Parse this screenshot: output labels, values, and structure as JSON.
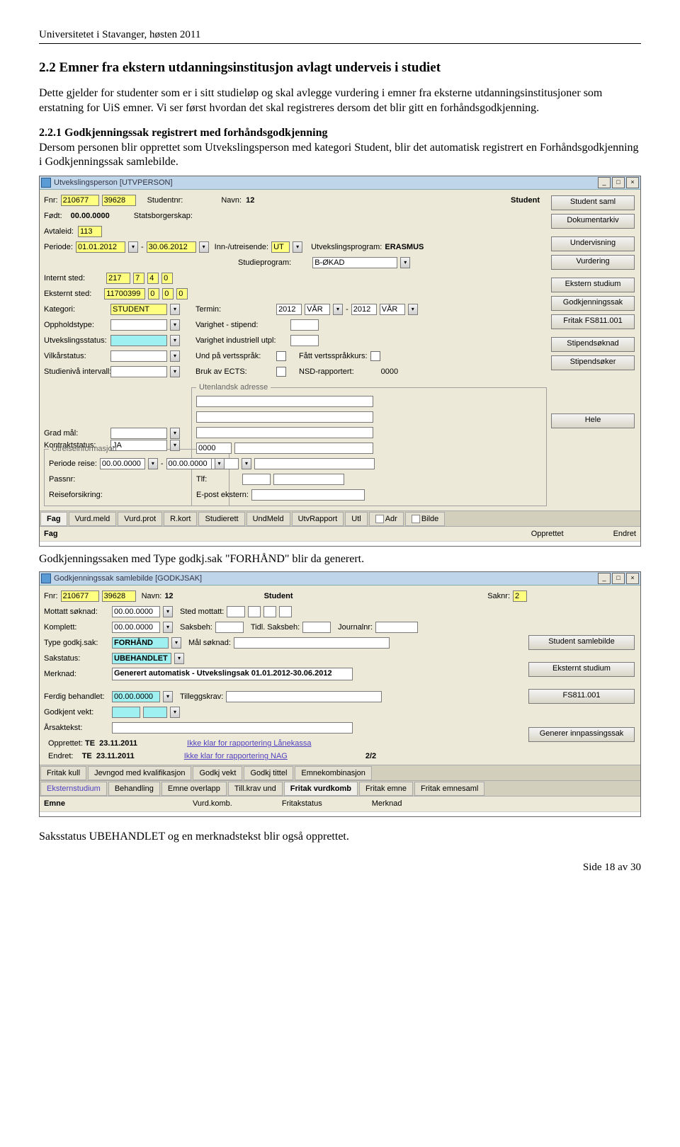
{
  "header": {
    "left": "Universitetet i Stavanger, høsten 2011",
    "right": ""
  },
  "h_section": "2.2 Emner fra ekstern utdanningsinstitusjon avlagt underveis i studiet",
  "intro": "Dette gjelder for studenter som er i sitt studieløp og skal avlegge vurdering i emner fra eksterne utdanningsinstitusjoner som erstatning for UiS emner. Vi ser først hvordan det skal registreres dersom det blir gitt en forhåndsgodkjenning.",
  "subhead": "2.2.1 Godkjenningssak registrert med forhåndsgodkjenning",
  "subtext": "Dersom personen blir opprettet som Utvekslingsperson med kategori Student, blir det automatisk registrert en Forhåndsgodkjenning i Godkjenningssak samlebilde.",
  "caption_mid": "Godkjenningssaken med Type godkj.sak \"FORHÅND\" blir da generert.",
  "foot_line": "Saksstatus UBEHANDLET og en merknadstekst blir også opprettet.",
  "page_footer": "Side 18 av 30",
  "up": {
    "title": "Utvekslingsperson  [UTVPERSON]",
    "fnr1": "210677",
    "fnr2": "39628",
    "studentnr_lbl": "Studentnr:",
    "navn_lbl": "Navn:",
    "navn_val": "12",
    "student_mark": "Student",
    "fodt_lbl": "Født:",
    "fodt_val": "00.00.0000",
    "stats_lbl": "Statsborgerskap:",
    "avtale_lbl": "Avtaleid:",
    "avtale_val": "113",
    "periode_lbl": "Periode:",
    "p_from": "01.01.2012",
    "p_to": "30.06.2012",
    "innut_lbl": "Inn-/utreisende:",
    "innut_val": "UT",
    "uprog_lbl": "Utvekslingsprogram:",
    "uprog_val": "ERASMUS",
    "sprog_lbl": "Studieprogram:",
    "sprog_val": "B-ØKAD",
    "isted_lbl": "Internt sted:",
    "isted_v1": "217",
    "isted_v2": "7",
    "isted_v3": "4",
    "isted_v4": "0",
    "ested_lbl": "Eksternt sted:",
    "ested_v1": "11700399",
    "ested_v2": "0",
    "ested_v3": "0",
    "ested_v4": "0",
    "kat_lbl": "Kategori:",
    "kat_val": "STUDENT",
    "term_lbl": "Termin:",
    "term_y1": "2012",
    "term_s1": "VÅR",
    "term_y2": "2012",
    "term_s2": "VÅR",
    "opph_lbl": "Oppholdstype:",
    "varst_lbl": "Varighet - stipend:",
    "ustat_lbl": "Utvekslingsstatus:",
    "varind_lbl": "Varighet industriell utpl:",
    "vilk_lbl": "Vilkårstatus:",
    "undv_lbl": "Und på vertsspråk:",
    "fvk_lbl": "Fått vertsspråkkurs:",
    "stniv_lbl": "Studienivå intervall:",
    "ects_lbl": "Bruk av ECTS:",
    "nsd_lbl": "NSD-rapportert:",
    "nsd_val": "0000",
    "kontr_lbl": "Kontraktstatus:",
    "kontr_val": "JA",
    "grad_lbl": "Grad mål:",
    "utenl_leg": "Utenlandsk adresse",
    "utreise_leg": "Utreiseinformasjon",
    "per_lbl": "Periode reise:",
    "per_from": "00.00.0000",
    "per_to": "00.00.0000",
    "pass_lbl": "Passnr:",
    "reise_lbl": "Reiseforsikring:",
    "addr_zero": "0000",
    "tlf_lbl": "Tlf:",
    "epost_lbl": "E-post ekstern:",
    "sidebtns": [
      "Student saml",
      "Dokumentarkiv",
      "Undervisning",
      "Vurdering",
      "Ekstern studium",
      "Godkjenningssak",
      "Fritak FS811.001",
      "Stipendsøknad",
      "Stipendsøker"
    ],
    "hele_btn": "Hele",
    "tabs": [
      "Fag",
      "Vurd.meld",
      "Vurd.prot",
      "R.kort",
      "Studierett",
      "UndMeld",
      "UtvRapport",
      "Utl",
      "Adr",
      "Bilde"
    ],
    "listcols": [
      "Fag",
      "Opprettet",
      "Endret"
    ]
  },
  "gs": {
    "title": "Godkjenningssak samlebilde  [GODKJSAK]",
    "fnr1": "210677",
    "fnr2": "39628",
    "navn_lbl": "Navn:",
    "navn_val": "12",
    "student_mark": "Student",
    "saknr_lbl": "Saknr:",
    "saknr_val": "2",
    "motts_lbl": "Mottatt søknad:",
    "motts_val": "00.00.0000",
    "stedm_lbl": "Sted mottatt:",
    "kompl_lbl": "Komplett:",
    "kompl_val": "00.00.0000",
    "saksb_lbl": "Saksbeh:",
    "tidlsb_lbl": "Tidl. Saksbeh:",
    "jnr_lbl": "Journalnr:",
    "type_lbl": "Type godkj.sak:",
    "type_val": "FORHÅND",
    "mals_lbl": "Mål søknad:",
    "sstat_lbl": "Sakstatus:",
    "sstat_val": "UBEHANDLET",
    "merk_lbl": "Merknad:",
    "merk_val": "Generert automatisk - Utvekslingsak 01.01.2012-30.06.2012",
    "ferd_lbl": "Ferdig behandlet:",
    "ferd_val": "00.00.0000",
    "tk_lbl": "Tilleggskrav:",
    "gv_lbl": "Godkjent vekt:",
    "aarsak_lbl": "Årsaktekst:",
    "opp_lbl": "Opprettet:",
    "opp_who": "TE",
    "opp_d": "23.11.2011",
    "end_lbl": "Endret:",
    "end_who": "TE",
    "end_d": "23.11.2011",
    "link1": "Ikke klar for rapportering Lånekassa",
    "link2": "Ikke klar for rapportering NAG",
    "pager": "2/2",
    "sidebtns": [
      "Student samlebilde",
      "Eksternt studium",
      "FS811.001",
      "Generer innpassingssak"
    ],
    "tabs1": [
      "Fritak kull",
      "Jevngod med kvalifikasjon",
      "Godkj vekt",
      "Godkj tittel",
      "Emnekombinasjon"
    ],
    "tabs2": [
      "Eksternstudium",
      "Behandling",
      "Emne overlapp",
      "Till.krav und",
      "Fritak vurdkomb",
      "Fritak emne",
      "Fritak emnesaml"
    ],
    "listcols": [
      "Emne",
      "Vurd.komb.",
      "Fritakstatus",
      "Merknad"
    ]
  }
}
